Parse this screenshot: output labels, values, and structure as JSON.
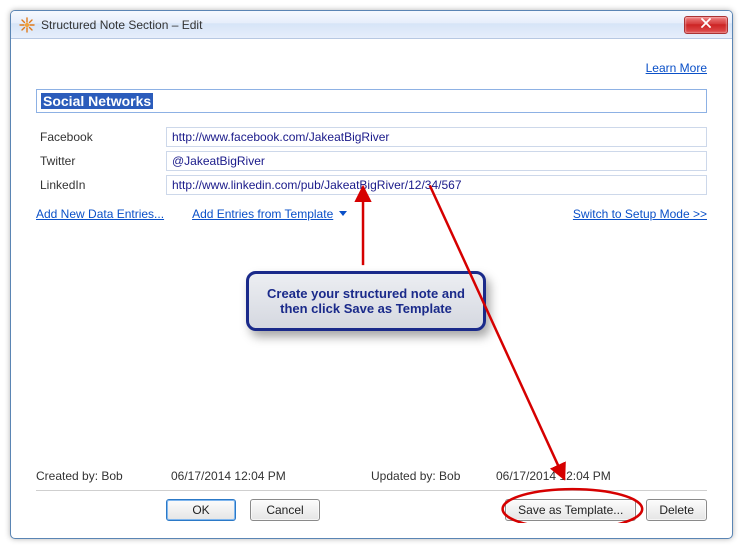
{
  "window": {
    "title": "Structured Note Section – Edit"
  },
  "links": {
    "learn_more": "Learn More",
    "add_new": "Add New Data Entries...",
    "add_template": "Add Entries from Template",
    "switch_mode": "Switch to Setup Mode >>"
  },
  "section": {
    "title": "Social Networks"
  },
  "entries": [
    {
      "label": "Facebook",
      "value": "http://www.facebook.com/JakeatBigRiver"
    },
    {
      "label": "Twitter",
      "value": "@JakeatBigRiver"
    },
    {
      "label": "LinkedIn",
      "value": "http://www.linkedin.com/pub/JakeatBigRiver/12/34/567"
    }
  ],
  "callout": {
    "line1": "Create your structured note and",
    "line2": "then click Save as Template"
  },
  "footer": {
    "created_label": "Created by: Bob",
    "created_time": "06/17/2014  12:04 PM",
    "updated_label": "Updated by: Bob",
    "updated_time": "06/17/2014  12:04 PM"
  },
  "buttons": {
    "ok": "OK",
    "cancel": "Cancel",
    "save_template": "Save as Template...",
    "delete": "Delete"
  }
}
